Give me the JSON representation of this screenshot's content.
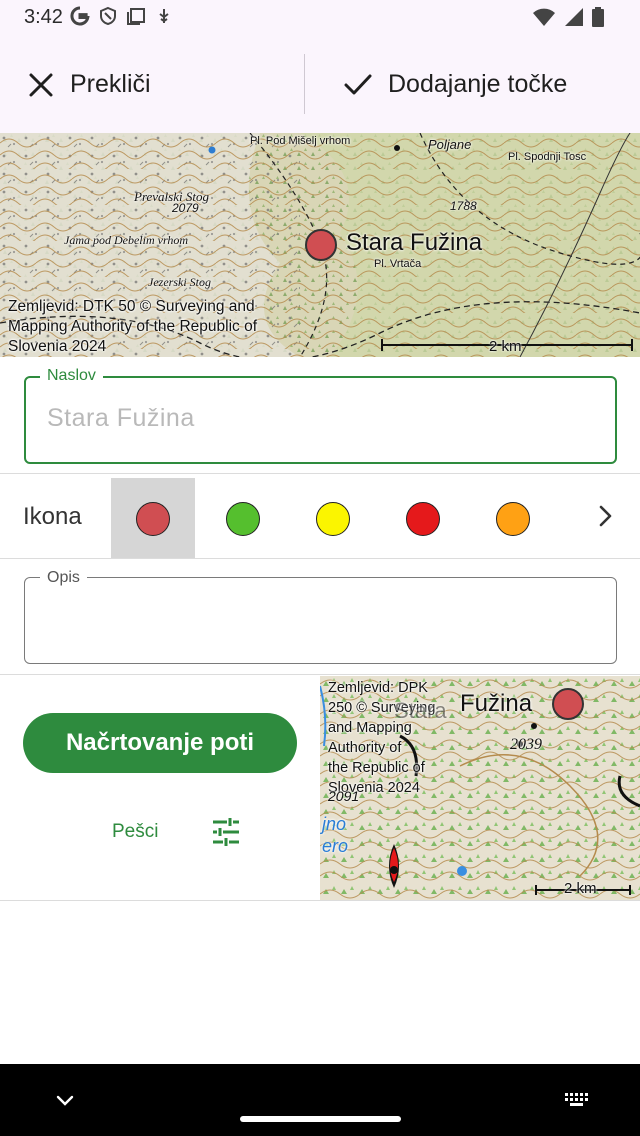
{
  "status_bar": {
    "time": "3:42"
  },
  "toolbar": {
    "cancel_label": "Prekliči",
    "add_label": "Dodajanje točke"
  },
  "map_top": {
    "marker_label": "Stara Fužina",
    "labels": [
      "Pl. Pod Mišelj vrhom",
      "Poljane",
      "Pl. Spodnji Tosc",
      "Prevalski Stog",
      "2079",
      "1788",
      "Jama pod Debelim vrhom",
      "Pl. Vrtača",
      "Jezerski Stog"
    ],
    "credit": [
      "Zemljevid: DTK 50 © Surveying and",
      "Mapping Authority of the Republic of",
      "Slovenia 2024"
    ],
    "scale": "2 km"
  },
  "form": {
    "title_label": "Naslov",
    "title_placeholder": "Stara Fužina",
    "icon_label": "Ikona",
    "icon_colors": [
      "#d04e52",
      "#55bf2e",
      "#fbf500",
      "#e5191b",
      "#ffa114"
    ],
    "description_label": "Opis"
  },
  "route": {
    "button_label": "Načrtovanje poti",
    "mode_label": "Pešci"
  },
  "map_small": {
    "marker_label": "Fužina",
    "partial_label": "Stara",
    "credit": [
      "Zemljevid: DPK",
      "250 © Surveying",
      "and Mapping",
      "Authority of",
      "the Republic of",
      "Slovenia 2024"
    ],
    "labels": [
      "2039",
      "2091",
      "jno",
      "ero"
    ],
    "scale": "2 km"
  },
  "colors": {
    "accent": "#2e8b3e",
    "surface": "#fbf5fd"
  }
}
